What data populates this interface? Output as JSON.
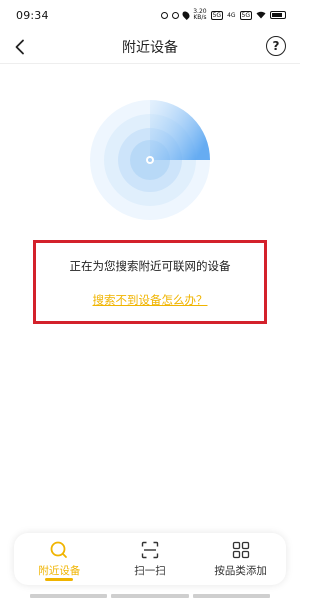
{
  "status_bar": {
    "time": "09:34",
    "speed": "3.20\nKB/s",
    "net1": "5G",
    "net2": "4G",
    "net3": "5G",
    "battery_icon": "battery-icon"
  },
  "header": {
    "title": "附近设备",
    "back_icon": "chevron-left-icon",
    "help_label": "?"
  },
  "search": {
    "status_text": "正在为您搜索附近可联网的设备",
    "help_link": "搜索不到设备怎么办？"
  },
  "tabs": [
    {
      "label": "附近设备",
      "icon": "search-icon",
      "active": true
    },
    {
      "label": "扫一扫",
      "icon": "scan-icon",
      "active": false
    },
    {
      "label": "按品类添加",
      "icon": "grid-icon",
      "active": false
    }
  ],
  "colors": {
    "accent": "#f0b400",
    "highlight_border": "#d3212b",
    "radar": "#5aa8f0"
  }
}
